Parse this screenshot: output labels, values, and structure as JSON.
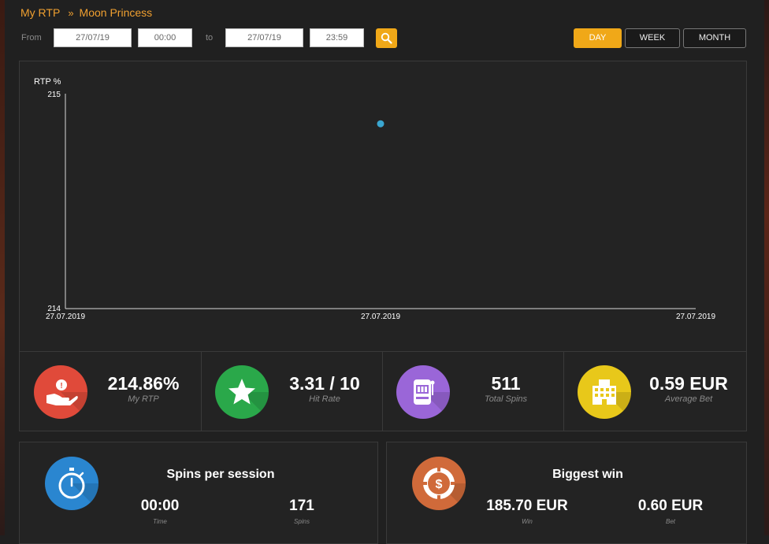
{
  "breadcrumb": {
    "parent": "My RTP",
    "separator": "»",
    "current": "Moon Princess"
  },
  "filter": {
    "from_label": "From",
    "from_date": "27/07/19",
    "from_time": "00:00",
    "to_label": "to",
    "to_date": "27/07/19",
    "to_time": "23:59"
  },
  "period": {
    "day": "DAY",
    "week": "WEEK",
    "month": "MONTH",
    "active": "DAY"
  },
  "chart_data": {
    "type": "scatter",
    "ylabel": "RTP %",
    "ylim": [
      214,
      215
    ],
    "y_ticks": [
      "215",
      "214"
    ],
    "x_ticks": [
      "27.07.2019",
      "27.07.2019",
      "27.07.2019"
    ],
    "points": [
      {
        "x": "27.07.2019",
        "y": 214.86
      }
    ],
    "point_color": "#3aa6d0",
    "grid": false
  },
  "stats": [
    {
      "value": "214.86%",
      "label": "My RTP",
      "icon": "hand-coin-icon",
      "color": "#e04a3a"
    },
    {
      "value": "3.31 / 10",
      "label": "Hit Rate",
      "icon": "star-icon",
      "color": "#2aa84a"
    },
    {
      "value": "511",
      "label": "Total Spins",
      "icon": "slot-machine-icon",
      "color": "#9a66d8"
    },
    {
      "value": "0.59 EUR",
      "label": "Average Bet",
      "icon": "casino-building-icon",
      "color": "#e8c81a"
    }
  ],
  "sessions": {
    "title": "Spins per session",
    "icon": "stopwatch-icon",
    "time_value": "00:00",
    "time_label": "Time",
    "spins_value": "171",
    "spins_label": "Spins"
  },
  "biggest_win": {
    "title": "Biggest win",
    "icon": "casino-chip-icon",
    "win_value": "185.70 EUR",
    "win_label": "Win",
    "bet_value": "0.60 EUR",
    "bet_label": "Bet"
  }
}
